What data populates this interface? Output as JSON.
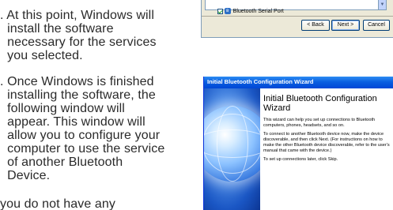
{
  "document": {
    "paragraph1": ". At this point, Windows will\n  install the software\n  necessary for the services\n  you selected.",
    "paragraph2": ". Once Windows is finished\n  installing the software, the\n  following window will\n  appear. This window will\n  allow you to configure your\n  computer to use the service\n  of another Bluetooth\n  Device.",
    "paragraph3": "you do not have any"
  },
  "top_dialog": {
    "service_item": "Bluetooth Serial Port",
    "service_checked": true,
    "back_button": "< Back",
    "next_button": "Next >",
    "cancel_button": "Cancel"
  },
  "wizard": {
    "window_title": "Initial Bluetooth Configuration Wizard",
    "heading": "Initial Bluetooth Configuration Wizard",
    "para1": "This wizard can help you set up connections to Bluetooth computers, phones, headsets, and so on.",
    "para2": "To connect to another Bluetooth device now, make the device discoverable, and then click Next. (For instructions on how to make the other Bluetooth device discoverable, refer to the user's manual that came with the device.)",
    "para3": "To set up connections later, click Skip."
  },
  "colors": {
    "titlebar": "#0a5fe0",
    "dialog_bg": "#ece9d8",
    "text": "#2a2a2a"
  }
}
